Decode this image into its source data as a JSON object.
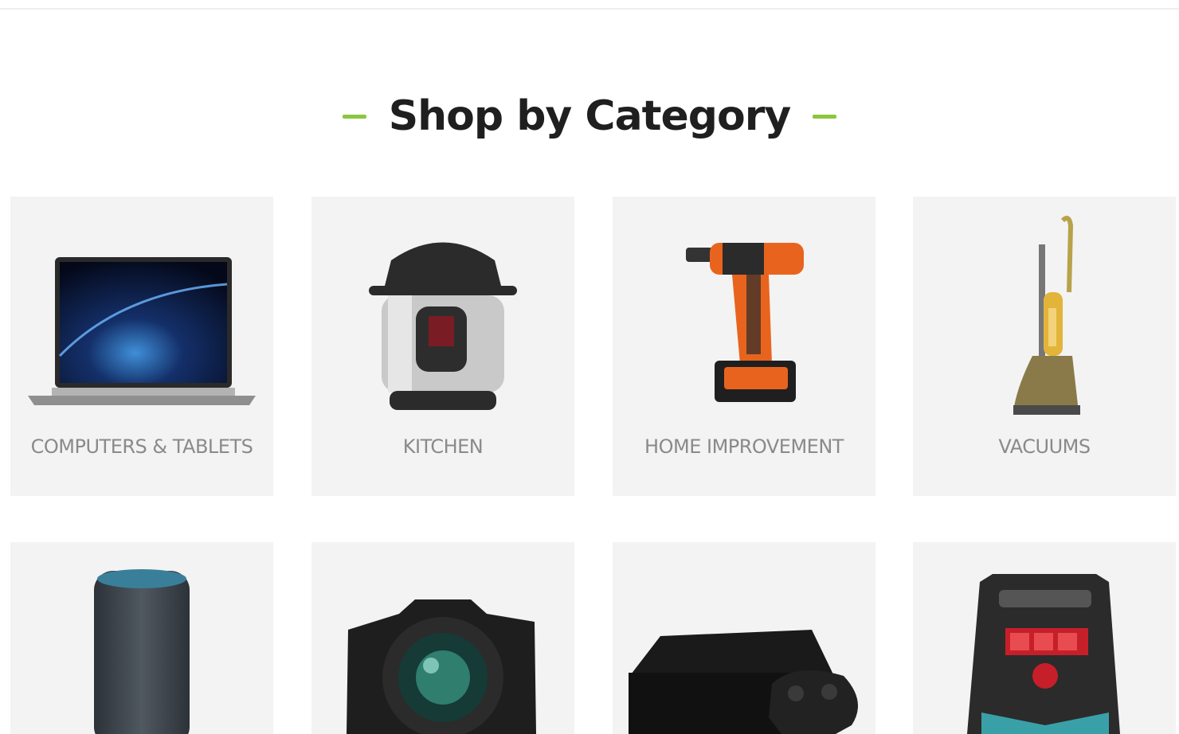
{
  "section": {
    "title": "Shop by Category"
  },
  "colors": {
    "accent": "#8cc63f",
    "card_bg": "#f3f3f3",
    "label": "#8a8a8a",
    "title": "#1f1f1f"
  },
  "categories": [
    {
      "label": "COMPUTERS & TABLETS",
      "icon": "laptop-icon"
    },
    {
      "label": "KITCHEN",
      "icon": "pressure-cooker-icon"
    },
    {
      "label": "HOME IMPROVEMENT",
      "icon": "power-drill-icon"
    },
    {
      "label": "VACUUMS",
      "icon": "upright-vacuum-icon"
    },
    {
      "label": "",
      "icon": "smart-speaker-icon"
    },
    {
      "label": "",
      "icon": "camera-icon"
    },
    {
      "label": "",
      "icon": "game-console-icon"
    },
    {
      "label": "",
      "icon": "battery-charger-icon"
    }
  ]
}
